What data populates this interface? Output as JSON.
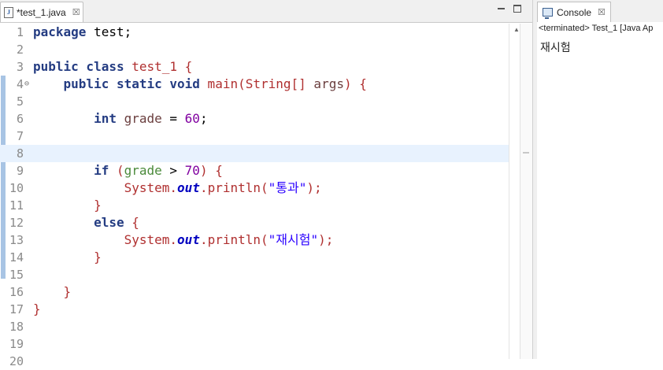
{
  "editor": {
    "tab_label": "*test_1.java",
    "tab_close": "☒",
    "lines": [
      {
        "n": "1"
      },
      {
        "n": "2"
      },
      {
        "n": "3"
      },
      {
        "n": "4"
      },
      {
        "n": "5"
      },
      {
        "n": "6"
      },
      {
        "n": "7"
      },
      {
        "n": "8"
      },
      {
        "n": "9"
      },
      {
        "n": "10"
      },
      {
        "n": "11"
      },
      {
        "n": "12"
      },
      {
        "n": "13"
      },
      {
        "n": "14"
      },
      {
        "n": "15"
      },
      {
        "n": "16"
      },
      {
        "n": "17"
      },
      {
        "n": "18"
      },
      {
        "n": "19"
      },
      {
        "n": "20"
      }
    ],
    "fold_marker": "⊖",
    "code": {
      "l1_kw": "package",
      "l1_rest": " test;",
      "l3_kw": "public class",
      "l3_cls": " test_1",
      "l3_brace": " {",
      "l4_kw": "public static void",
      "l4_main": " main",
      "l4_paren": "(",
      "l4_type": "String",
      "l4_arr": "[]",
      "l4_args": " args",
      "l4_close": ") {",
      "l6_kw": "int",
      "l6_var": " grade",
      "l6_eq": " = ",
      "l6_num": "60",
      "l6_end": ";",
      "l9_kw": "if",
      "l9_open": " (",
      "l9_var": "grade",
      "l9_gt": " > ",
      "l9_num": "70",
      "l9_close": ") {",
      "l10_sys": "System.",
      "l10_out": "out",
      "l10_dot": ".",
      "l10_meth": "println",
      "l10_p": "(",
      "l10_str": "\"통과\"",
      "l10_end": ");",
      "l11_brace": "}",
      "l12_kw": "else",
      "l12_brace": " {",
      "l13_sys": "System.",
      "l13_out": "out",
      "l13_dot": ".",
      "l13_meth": "println",
      "l13_p": "(",
      "l13_str": "\"재시험\"",
      "l13_end": ");",
      "l14_brace": "}",
      "l16_brace": "}",
      "l17_brace": "}"
    }
  },
  "console": {
    "tab_label": "Console",
    "tab_close": "☒",
    "status": "<terminated> Test_1 [Java Ap",
    "output": "재시험"
  }
}
